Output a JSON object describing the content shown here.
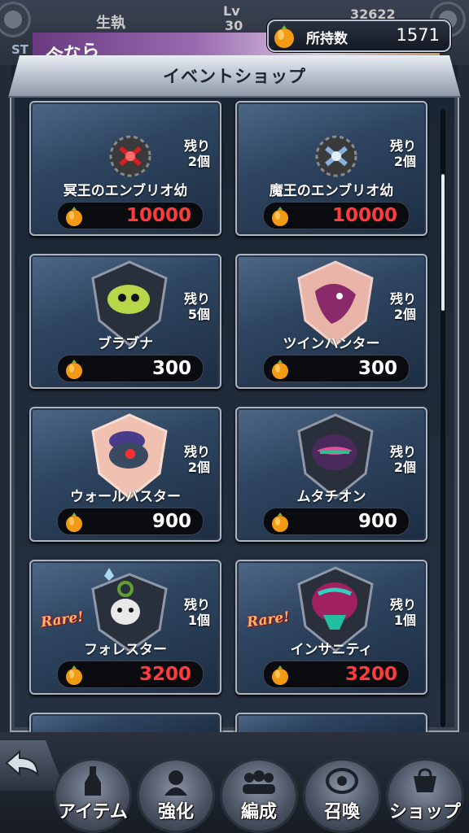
{
  "background": {
    "labels": [
      "生執",
      "Lv",
      "30",
      "32622",
      "ST",
      "今なら"
    ]
  },
  "currency": {
    "label": "所持数",
    "value": "1571",
    "icon": "orange-gem-icon"
  },
  "shop": {
    "title": "イベントショップ",
    "scroll_position": 0.12,
    "items": [
      {
        "name": "冥王のエンブリオ幼",
        "stock_line1": "残り",
        "stock_line2": "2個",
        "price": "10000",
        "price_color": "#ff3b3b",
        "rare": false,
        "icon": "embryo-red-icon"
      },
      {
        "name": "魔王のエンブリオ幼",
        "stock_line1": "残り",
        "stock_line2": "2個",
        "price": "10000",
        "price_color": "#ff3b3b",
        "rare": false,
        "icon": "embryo-blue-icon"
      },
      {
        "name": "ブラブナ",
        "stock_line1": "残り",
        "stock_line2": "5個",
        "price": "300",
        "price_color": "#ffffff",
        "rare": false,
        "icon": "shield-monster-green-icon"
      },
      {
        "name": "ツインハンター",
        "stock_line1": "残り",
        "stock_line2": "2個",
        "price": "300",
        "price_color": "#ffffff",
        "rare": false,
        "icon": "shield-monster-pink-icon"
      },
      {
        "name": "ウォールバスター",
        "stock_line1": "残り",
        "stock_line2": "2個",
        "price": "900",
        "price_color": "#ffffff",
        "rare": false,
        "icon": "shield-monster-purple-icon"
      },
      {
        "name": "ムタチオン",
        "stock_line1": "残り",
        "stock_line2": "2個",
        "price": "900",
        "price_color": "#ffffff",
        "rare": false,
        "icon": "shield-monster-mask-icon"
      },
      {
        "name": "フォレスター",
        "stock_line1": "残り",
        "stock_line2": "1個",
        "price": "3200",
        "price_color": "#ff3b3b",
        "rare": true,
        "rare_label": "Rare!",
        "icon": "shield-monster-white-icon"
      },
      {
        "name": "インサニティ",
        "stock_line1": "残り",
        "stock_line2": "1個",
        "price": "3200",
        "price_color": "#ff3b3b",
        "rare": true,
        "rare_label": "Rare!",
        "icon": "shield-monster-teal-icon"
      }
    ]
  },
  "nav": {
    "items": [
      {
        "label": "アイテム",
        "icon": "potion-icon"
      },
      {
        "label": "強化",
        "icon": "enhance-icon"
      },
      {
        "label": "編成",
        "icon": "formation-icon"
      },
      {
        "label": "召喚",
        "icon": "summon-icon"
      },
      {
        "label": "ショップ",
        "icon": "shop-icon"
      }
    ]
  }
}
